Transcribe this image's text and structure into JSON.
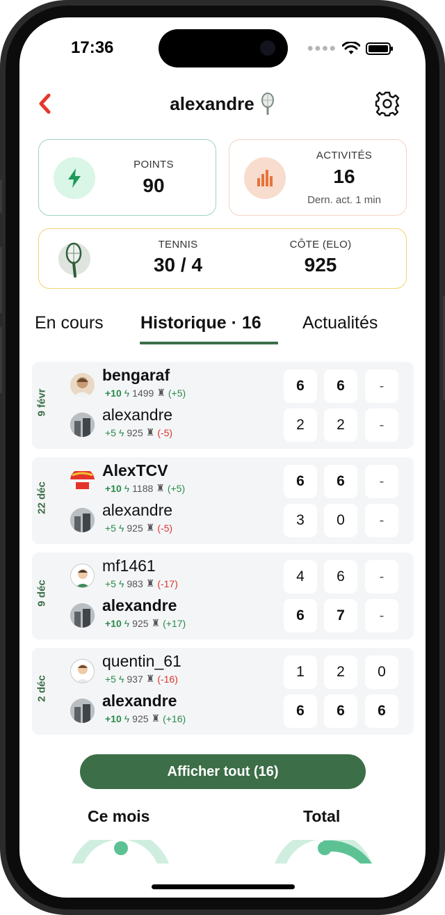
{
  "status": {
    "time": "17:36"
  },
  "header": {
    "title": "alexandre",
    "back_icon": "chevron-left-icon",
    "settings_icon": "gear-icon",
    "accent_color": "#e5372b"
  },
  "cards": {
    "points": {
      "label": "POINTS",
      "value": "90",
      "icon": "bolt-icon"
    },
    "activities": {
      "label": "ACTIVITÉS",
      "value": "16",
      "sub": "Dern. act. 1 min",
      "icon": "bar-chart-icon"
    },
    "tennis": {
      "label": "TENNIS",
      "value": "30 / 4",
      "elo_label": "CÔTE (ELO)",
      "elo_value": "925",
      "icon": "tennis-racket-icon"
    }
  },
  "tabs": [
    {
      "label": "En cours"
    },
    {
      "label": "Historique · 16",
      "active": true
    },
    {
      "label": "Actualités"
    }
  ],
  "matches": [
    {
      "date": "9 févr",
      "players": [
        {
          "name": "bengaraf",
          "gain": "+10",
          "elo": "1499",
          "delta": "(+5)",
          "winner": true,
          "scores": [
            "6",
            "6",
            "-"
          ]
        },
        {
          "name": "alexandre",
          "gain": "+5",
          "elo": "925",
          "delta": "(-5)",
          "winner": false,
          "scores": [
            "2",
            "2",
            "-"
          ]
        }
      ]
    },
    {
      "date": "22 déc",
      "players": [
        {
          "name": "AlexTCV",
          "gain": "+10",
          "elo": "1188",
          "delta": "(+5)",
          "winner": true,
          "scores": [
            "6",
            "6",
            "-"
          ]
        },
        {
          "name": "alexandre",
          "gain": "+5",
          "elo": "925",
          "delta": "(-5)",
          "winner": false,
          "scores": [
            "3",
            "0",
            "-"
          ]
        }
      ]
    },
    {
      "date": "9 déc",
      "players": [
        {
          "name": "mf1461",
          "gain": "+5",
          "elo": "983",
          "delta": "(-17)",
          "winner": false,
          "scores": [
            "4",
            "6",
            "-"
          ]
        },
        {
          "name": "alexandre",
          "gain": "+10",
          "elo": "925",
          "delta": "(+17)",
          "winner": true,
          "scores": [
            "6",
            "7",
            "-"
          ]
        }
      ]
    },
    {
      "date": "2 déc",
      "players": [
        {
          "name": "quentin_61",
          "gain": "+5",
          "elo": "937",
          "delta": "(-16)",
          "winner": false,
          "scores": [
            "1",
            "2",
            "0"
          ]
        },
        {
          "name": "alexandre",
          "gain": "+10",
          "elo": "925",
          "delta": "(+16)",
          "winner": true,
          "scores": [
            "6",
            "6",
            "6"
          ]
        }
      ]
    }
  ],
  "show_all": {
    "label": "Afficher tout (16)",
    "color": "#3c6e48"
  },
  "sections": {
    "month": "Ce mois",
    "total": "Total"
  }
}
